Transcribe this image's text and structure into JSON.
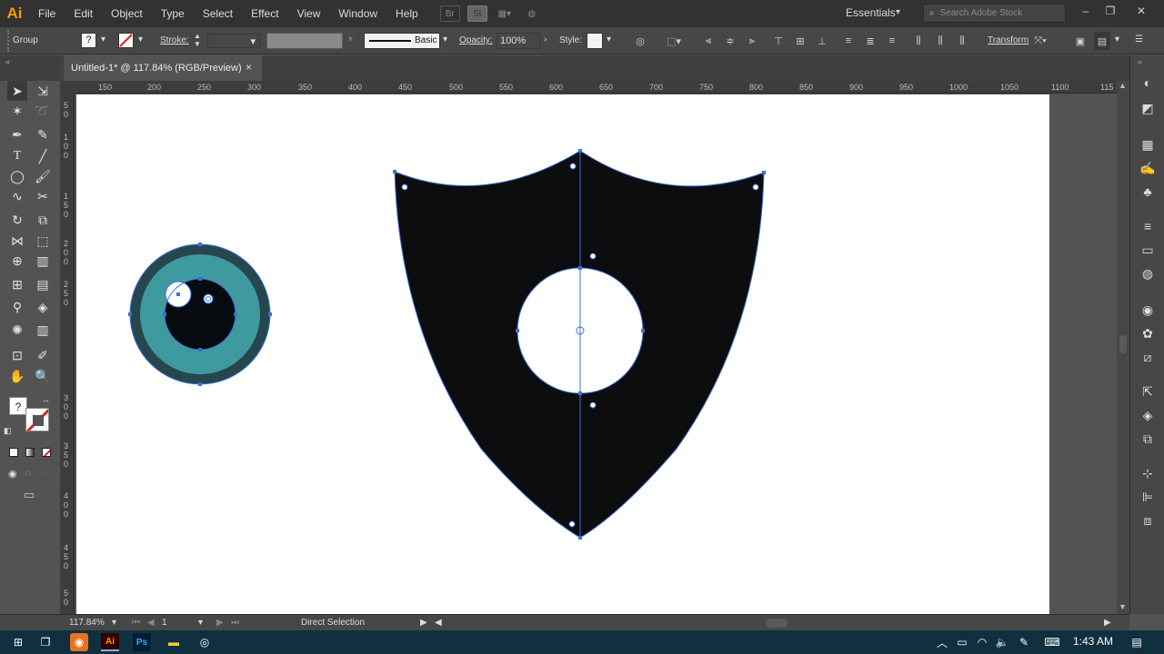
{
  "app": {
    "logo": "Ai"
  },
  "menu": [
    "File",
    "Edit",
    "Object",
    "Type",
    "Select",
    "Effect",
    "View",
    "Window",
    "Help"
  ],
  "menu_icons": [
    "bridge-icon",
    "stock-icon",
    "arrange-icon",
    "gpu-icon"
  ],
  "menu_icon_labels": [
    "Br",
    "St"
  ],
  "workspace": "Essentials",
  "search": {
    "placeholder": "Search Adobe Stock"
  },
  "control": {
    "selection_type": "Group",
    "fill_label": "?",
    "stroke_label": "Stroke:",
    "brush_label": "Basic",
    "opacity_label": "Opacity:",
    "opacity_value": "100%",
    "style_label": "Style:",
    "transform_label": "Transform"
  },
  "document": {
    "tab_title": "Untitled-1* @ 117.84% (RGB/Preview)",
    "close_glyph": "×"
  },
  "ruler_top": [
    "150",
    "200",
    "250",
    "300",
    "350",
    "400",
    "450",
    "500",
    "550",
    "600",
    "650",
    "700",
    "750",
    "800",
    "850",
    "900",
    "950",
    "1000",
    "1050",
    "1100",
    "115"
  ],
  "ruler_left": [
    "5",
    "0",
    "1",
    "0",
    "0",
    "1",
    "5",
    "0",
    "2",
    "0",
    "0",
    "2",
    "5",
    "0",
    "3",
    "0",
    "0",
    "3",
    "5",
    "0",
    "4",
    "0",
    "0",
    "4",
    "5",
    "0",
    "5",
    "0"
  ],
  "status": {
    "zoom": "117.84%",
    "artboard": "1",
    "tool": "Direct Selection"
  },
  "taskbar": {
    "time": "1:43 AM"
  },
  "colors": {
    "shield": "#0d0d0f",
    "eye_outer": "#27474e",
    "eye_iris": "#3f9aa0",
    "pupil": "#070b10",
    "anchor": "#3d6fd8"
  }
}
